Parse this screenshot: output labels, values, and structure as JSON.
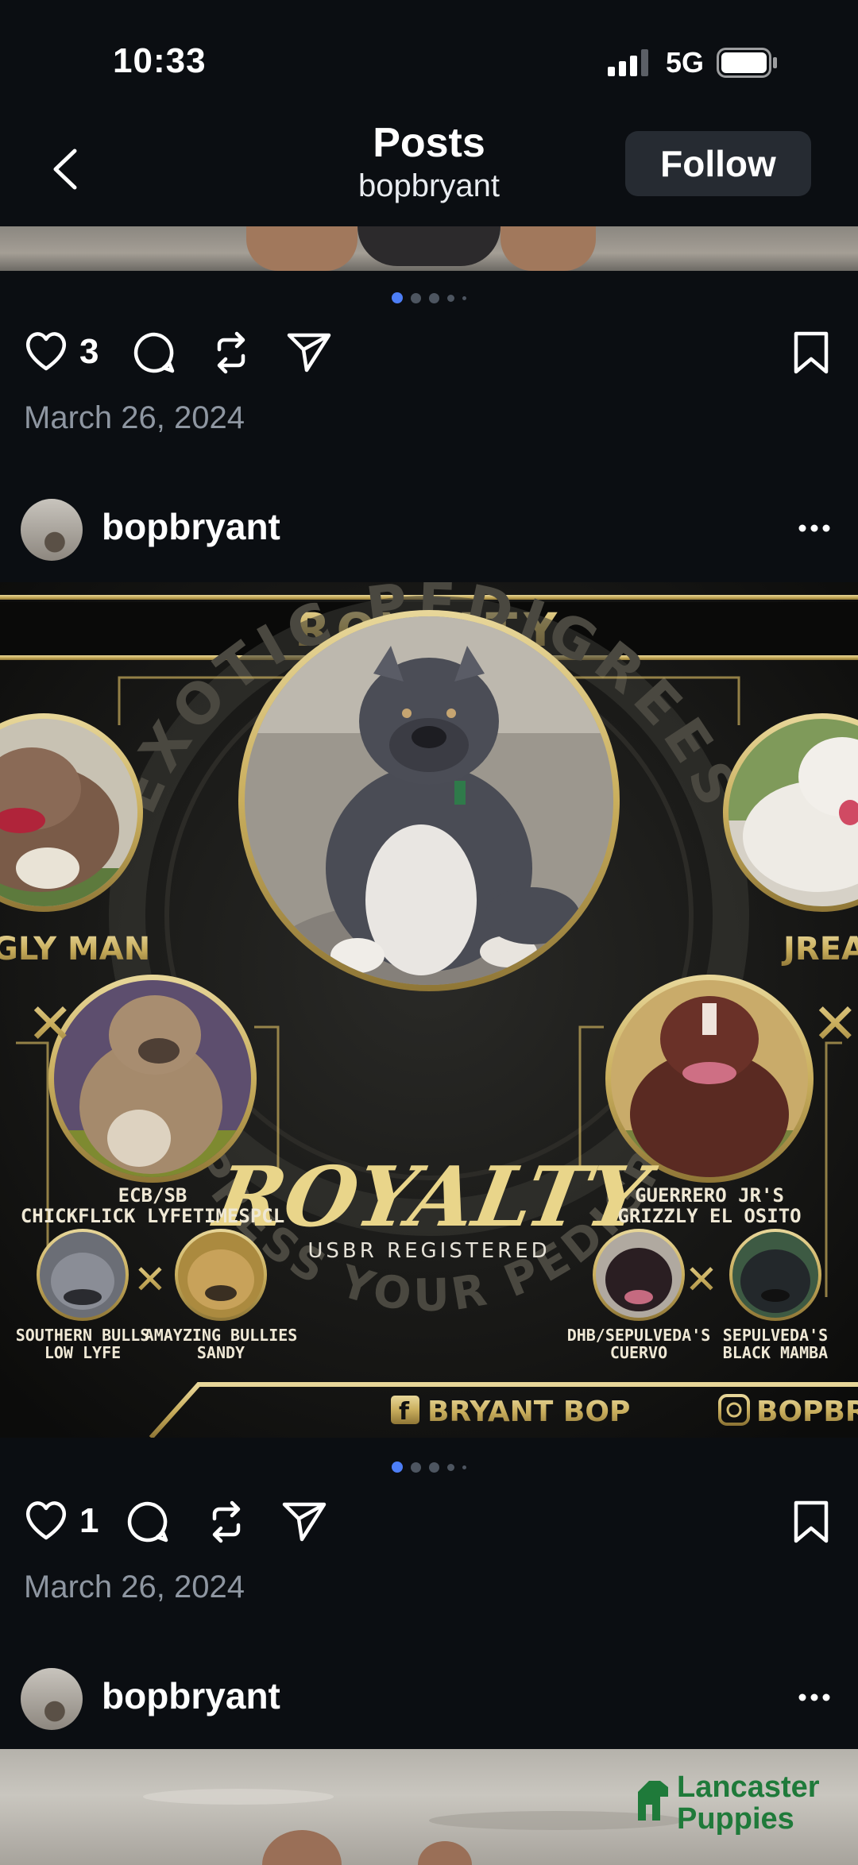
{
  "status_bar": {
    "time": "10:33",
    "network": "5G"
  },
  "header": {
    "title": "Posts",
    "subtitle": "bopbryant",
    "follow_label": "Follow"
  },
  "post1": {
    "likes": "3",
    "date": "March 26, 2024",
    "carousel": {
      "count": 5,
      "active": 0
    }
  },
  "post2": {
    "author": "bopbryant",
    "likes": "1",
    "date": "March 26, 2024",
    "carousel": {
      "count": 5,
      "active": 0
    },
    "graphic": {
      "banner": "ROYALTY",
      "arc_text": "EXOTIC PEDIGREES",
      "arc_text_bottom": "EXPRESS YOUR PEDIGREE",
      "script_title": "ROYALTY",
      "registry": "USBR REGISTERED",
      "left_name": "GLY MAN",
      "right_name": "JREA",
      "sire_left": "ECB/SB\nCHICKFLICK LYFETIMESPCL",
      "sire_right": "GUERRERO JR'S\nGRIZZLY EL OSITO",
      "gp1": "SOUTHERN BULLS\nLOW LYFE",
      "gp2": "AMAYZING BULLIES\nSANDY",
      "gp3": "DHB/SEPULVEDA'S\nCUERVO",
      "gp4": "SEPULVEDA'S\nBLACK MAMBA",
      "facebook": "BRYANT BOP",
      "instagram": "BOPBRY"
    }
  },
  "post3": {
    "author": "bopbryant"
  },
  "watermark": {
    "line1": "Lancaster",
    "line2": "Puppies"
  }
}
